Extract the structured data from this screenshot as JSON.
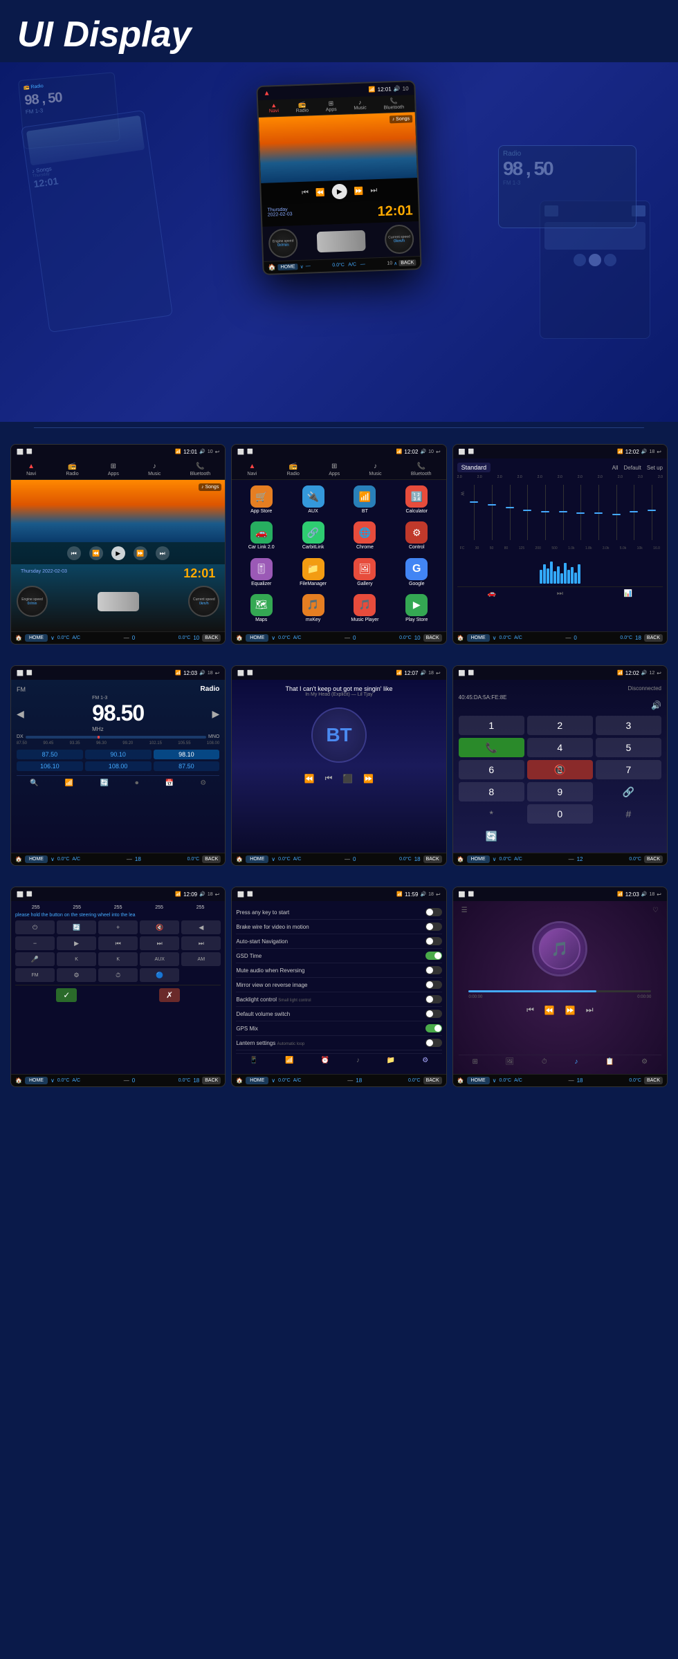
{
  "header": {
    "title": "UI Display"
  },
  "hero": {
    "time": "12:01",
    "date": "Thursday\n2022-02-03",
    "song": "♪ Songs",
    "freq": "98.50",
    "back_label": "BACK",
    "home_label": "HOME",
    "temp": "0.0°C",
    "ac": "A/C"
  },
  "screens": {
    "home": {
      "time": "12:01",
      "date": "Thursday 2022-02-03",
      "song": "♪ Songs",
      "status_time": "12:01",
      "battery": "10",
      "nav_items": [
        "Navi",
        "Radio",
        "Apps",
        "Music",
        "Bluetooth"
      ],
      "temp": "0.0°C",
      "home_label": "HOME",
      "back_label": "BACK"
    },
    "apps": {
      "status_time": "12:02",
      "battery": "10",
      "items": [
        {
          "name": "App Store",
          "color": "#e67e22",
          "icon": "🛒"
        },
        {
          "name": "AUX",
          "color": "#3498db",
          "icon": "🔌"
        },
        {
          "name": "BT",
          "color": "#2980b9",
          "icon": "📶"
        },
        {
          "name": "Calculator",
          "color": "#e74c3c",
          "icon": "🔢"
        },
        {
          "name": "Car Link 2.0",
          "color": "#27ae60",
          "icon": "🚗"
        },
        {
          "name": "CarbitLink",
          "color": "#2ecc71",
          "icon": "🔗"
        },
        {
          "name": "Chrome",
          "color": "#e74c3c",
          "icon": "🌐"
        },
        {
          "name": "Control",
          "color": "#e74c3c",
          "icon": "⚙"
        },
        {
          "name": "Equalizer",
          "color": "#9b59b6",
          "icon": "🎚"
        },
        {
          "name": "FileManager",
          "color": "#f39c12",
          "icon": "📁"
        },
        {
          "name": "Gallery",
          "color": "#e74c3c",
          "icon": "🖼"
        },
        {
          "name": "Google",
          "color": "#4285f4",
          "icon": "G"
        },
        {
          "name": "Maps",
          "color": "#34a853",
          "icon": "🗺"
        },
        {
          "name": "mxKey",
          "color": "#e67e22",
          "icon": "🎵"
        },
        {
          "name": "Music Player",
          "color": "#e74c3c",
          "icon": "🎵"
        },
        {
          "name": "Play Store",
          "color": "#34a853",
          "icon": "▶"
        }
      ]
    },
    "eq": {
      "status_time": "12:02",
      "battery": "18",
      "preset": "Standard",
      "all_label": "All",
      "default_label": "Default",
      "setup_label": "Set up",
      "freq_labels": [
        "FC",
        "30",
        "50",
        "80",
        "125",
        "200",
        "500",
        "1.0k",
        "1.8k",
        "3.0k",
        "5.0k",
        "10k",
        "13.0 16.0"
      ]
    },
    "radio": {
      "status_time": "12:03",
      "battery": "18",
      "band": "FM",
      "label": "Radio",
      "freq": "98.50",
      "unit": "MHz",
      "band_type": "FM 1-3",
      "dx_label": "DX",
      "mono_label": "MNO",
      "scale_labels": [
        "87.50",
        "90.45",
        "93.35",
        "96.30",
        "99.20",
        "102.15",
        "105.55",
        "108.00"
      ],
      "presets": [
        "87.50",
        "90.10",
        "98.10",
        "106.10",
        "108.00",
        "87.50"
      ],
      "bottom_icons": [
        "search",
        "eq",
        "loop",
        "record",
        "calendar",
        "settings"
      ]
    },
    "bluetooth": {
      "status_time": "12:07",
      "battery": "18",
      "song_title": "That I can't keep out got me singin' like",
      "song_sub": "In My Head (Explicit) — Lil Tjay",
      "bt_label": "BT"
    },
    "phone": {
      "status_time": "12:02",
      "battery": "12",
      "status": "Disconnected",
      "device": "40:45:DA:5A:FE:8E",
      "keypad": [
        "1",
        "2",
        "3",
        "📞",
        "4",
        "5",
        "6",
        "📵",
        "7",
        "8",
        "9",
        "🔗",
        "*",
        "0",
        "#",
        "🔄"
      ]
    },
    "steering": {
      "status_time": "12:09",
      "battery": "18",
      "hint": "please hold the button on the steering wheel into the lea",
      "key_labels": [
        "255",
        "255",
        "255",
        "255",
        "255"
      ],
      "icons": [
        "⏻",
        "🔄",
        "🔊",
        "🔇",
        "◀",
        "🔊",
        "⏭",
        "⏮",
        "⏭",
        "⏮",
        "🎤",
        "K",
        "K",
        "AUX",
        "AM",
        "FM",
        "⚙",
        "⏱",
        "🔵"
      ],
      "confirm": "✓",
      "cancel": "✗"
    },
    "settings": {
      "status_time": "11:59",
      "battery": "18",
      "items": [
        {
          "label": "Press any key to start",
          "value": "off"
        },
        {
          "label": "Brake wire for video in motion",
          "value": "off"
        },
        {
          "label": "Auto-start Navigation",
          "value": "off"
        },
        {
          "label": "GSD Time",
          "value": "on"
        },
        {
          "label": "Mute audio when Reversing",
          "value": "off"
        },
        {
          "label": "Mirror view on reverse image",
          "value": "off"
        },
        {
          "label": "Backlight control",
          "sublabel": "Small light control",
          "value": "off"
        },
        {
          "label": "Default volume switch",
          "value": "off"
        },
        {
          "label": "GPS Mix",
          "value": "on"
        },
        {
          "label": "Lantern settings",
          "sublabel": "Automatic loop",
          "value": "off"
        }
      ]
    },
    "music": {
      "status_time": "12:03",
      "battery": "18",
      "progress": "0:00:00",
      "duration": "0:00:00"
    }
  },
  "common": {
    "home_label": "HOME",
    "back_label": "BACK",
    "temp": "0.0°C",
    "ac": "A/C",
    "zero_val": "0"
  }
}
